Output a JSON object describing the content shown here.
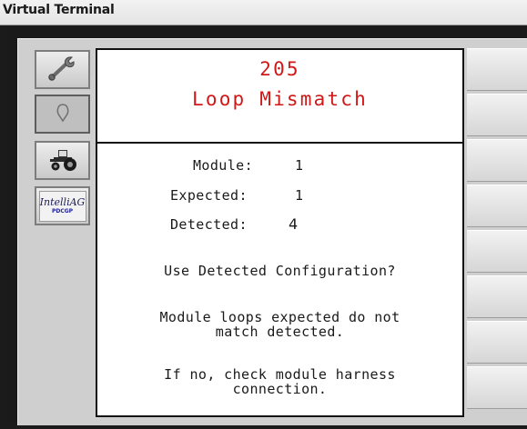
{
  "window": {
    "title": "Virtual Terminal"
  },
  "sidebar": {
    "buttons": [
      {
        "icon": "wrench-icon"
      },
      {
        "icon": "loop-icon"
      },
      {
        "icon": "tractor-icon"
      },
      {
        "icon": "intelliag-logo",
        "logo_text": "IntelliAG",
        "logo_sub": "PDCGP"
      }
    ]
  },
  "dialog": {
    "code": "205",
    "title": "Loop Mismatch",
    "module_label": "Module:",
    "module_value": "1",
    "expected_label": "Expected:",
    "expected_value": "1",
    "detected_label": "Detected:",
    "detected_value": "4",
    "question": "Use Detected Configuration?",
    "message_line1": "Module loops expected do not",
    "message_line2": "match detected.",
    "hint_line1": "If no, check module harness",
    "hint_line2": "connection."
  },
  "colors": {
    "alert_red": "#d01818",
    "panel_gray": "#cfcfcf"
  }
}
